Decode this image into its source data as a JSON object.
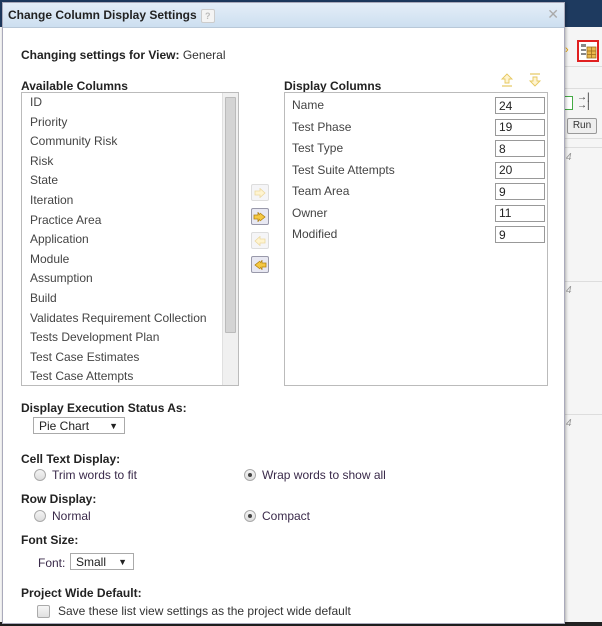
{
  "dialog": {
    "title": "Change Column Display Settings",
    "help_icon": "?",
    "close_icon": "✕",
    "view_label": "Changing settings for View:",
    "view_name": "General"
  },
  "available": {
    "label": "Available Columns",
    "items": [
      "ID",
      "Priority",
      "Community Risk",
      "Risk",
      "State",
      "Iteration",
      "Practice Area",
      "Application",
      "Module",
      "Assumption",
      "Build",
      "Validates Requirement Collection",
      "Tests Development Plan",
      "Test Case Estimates",
      "Test Case Attempts"
    ]
  },
  "display": {
    "label": "Display Columns",
    "rows": [
      {
        "name": "Name",
        "width": "24"
      },
      {
        "name": "Test Phase",
        "width": "19"
      },
      {
        "name": "Test Type",
        "width": "8"
      },
      {
        "name": "Test Suite Attempts",
        "width": "20"
      },
      {
        "name": "Team Area",
        "width": "9"
      },
      {
        "name": "Owner",
        "width": "11"
      },
      {
        "name": "Modified",
        "width": "9"
      }
    ]
  },
  "move_buttons": [
    "add-icon",
    "add-all-icon",
    "remove-icon",
    "remove-all-icon"
  ],
  "execution_status": {
    "label": "Display Execution Status As:",
    "selected": "Pie Chart"
  },
  "cell_text": {
    "label": "Cell Text Display:",
    "options": [
      {
        "label": "Trim words to fit",
        "checked": false
      },
      {
        "label": "Wrap words to show all",
        "checked": true
      }
    ]
  },
  "row_display": {
    "label": "Row Display:",
    "options": [
      {
        "label": "Normal",
        "checked": false
      },
      {
        "label": "Compact",
        "checked": true
      }
    ]
  },
  "font_size": {
    "label": "Font Size:",
    "font_label": "Font:",
    "selected": "Small"
  },
  "project_default": {
    "label": "Project Wide Default:",
    "checkbox_label": "Save these list view settings as the project wide default",
    "checked": false
  },
  "background": {
    "run_label": "Run",
    "row_values": [
      "4",
      "4",
      "4"
    ]
  },
  "colors": {
    "accent_arrow": "#e6b400",
    "highlight_border": "#e02020",
    "titlebar": "#cddff0"
  }
}
